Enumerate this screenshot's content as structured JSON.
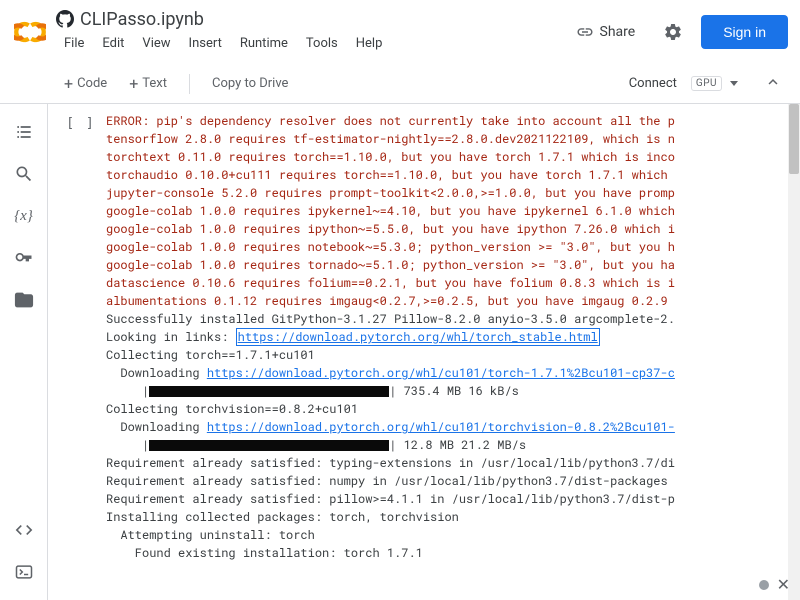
{
  "header": {
    "title": "CLIPasso.ipynb",
    "menus": [
      "File",
      "Edit",
      "View",
      "Insert",
      "Runtime",
      "Tools",
      "Help"
    ],
    "share": "Share",
    "signin": "Sign in"
  },
  "toolbar": {
    "code": "Code",
    "text": "Text",
    "copy": "Copy to Drive",
    "connect": "Connect",
    "gpu": "GPU"
  },
  "gutter": "[ ]",
  "output": {
    "err1": "ERROR: pip's dependency resolver does not currently take into account all the p",
    "err2": "tensorflow 2.8.0 requires tf-estimator-nightly==2.8.0.dev2021122109, which is n",
    "err3": "torchtext 0.11.0 requires torch==1.10.0, but you have torch 1.7.1 which is inco",
    "err4": "torchaudio 0.10.0+cu111 requires torch==1.10.0, but you have torch 1.7.1 which ",
    "err5": "jupyter-console 5.2.0 requires prompt-toolkit<2.0.0,>=1.0.0, but you have promp",
    "err6": "google-colab 1.0.0 requires ipykernel~=4.10, but you have ipykernel 6.1.0 which",
    "err7": "google-colab 1.0.0 requires ipython~=5.5.0, but you have ipython 7.26.0 which i",
    "err8": "google-colab 1.0.0 requires notebook~=5.3.0; python_version >= \"3.0\", but you h",
    "err9": "google-colab 1.0.0 requires tornado~=5.1.0; python_version >= \"3.0\", but you ha",
    "err10": "datascience 0.10.6 requires folium==0.2.1, but you have folium 0.8.3 which is i",
    "err11": "albumentations 0.1.12 requires imgaug<0.2.7,>=0.2.5, but you have imgaug 0.2.9 ",
    "l1": "Successfully installed GitPython-3.1.27 Pillow-8.2.0 anyio-3.5.0 argcomplete-2.",
    "l2a": "Looking in links: ",
    "l2link": "https://download.pytorch.org/whl/torch_stable.html",
    "l3": "Collecting torch==1.7.1+cu101",
    "l4a": "  Downloading ",
    "l4link": "https://download.pytorch.org/whl/cu101/torch-1.7.1%2Bcu101-cp37-c",
    "l5a": "     |",
    "l5b": "| 735.4 MB 16 kB/s",
    "l6": "Collecting torchvision==0.8.2+cu101",
    "l7a": "  Downloading ",
    "l7link": "https://download.pytorch.org/whl/cu101/torchvision-0.8.2%2Bcu101-",
    "l8a": "     |",
    "l8b": "| 12.8 MB 21.2 MB/s",
    "l9": "Requirement already satisfied: typing-extensions in /usr/local/lib/python3.7/di",
    "l10": "Requirement already satisfied: numpy in /usr/local/lib/python3.7/dist-packages ",
    "l11": "Requirement already satisfied: pillow>=4.1.1 in /usr/local/lib/python3.7/dist-p",
    "l12": "Installing collected packages: torch, torchvision",
    "l13": "  Attempting uninstall: torch",
    "l14": "    Found existing installation: torch 1.7.1"
  }
}
